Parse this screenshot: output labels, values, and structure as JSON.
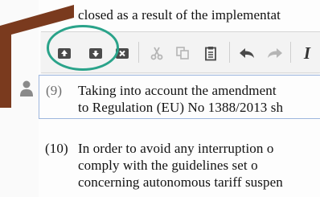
{
  "document": {
    "top_line": "closed as a result of the implementat",
    "para9": {
      "number": "(9)",
      "line1": "Taking into account the amendment",
      "line2": "to Regulation (EU) No 1388/2013 sh"
    },
    "para10": {
      "number": "(10)",
      "line1": "In order to avoid any interruption o",
      "line2": "comply with the guidelines set o",
      "line3": "concerning autonomous tariff suspen"
    }
  },
  "toolbar": {
    "buttons": [
      {
        "name": "insert-above-icon",
        "enabled": true
      },
      {
        "name": "insert-below-icon",
        "enabled": true
      },
      {
        "name": "delete-paragraph-icon",
        "enabled": true
      },
      {
        "name": "cut-icon",
        "enabled": false
      },
      {
        "name": "copy-icon",
        "enabled": false
      },
      {
        "name": "paste-icon",
        "enabled": true
      },
      {
        "name": "undo-icon",
        "enabled": true
      },
      {
        "name": "redo-icon",
        "enabled": false
      },
      {
        "name": "italic-icon",
        "enabled": true
      }
    ],
    "italic_label": "I"
  },
  "colors": {
    "highlight": "#2aa38a",
    "bracket": "#7a3a1e",
    "selection_border": "#9db6de"
  }
}
